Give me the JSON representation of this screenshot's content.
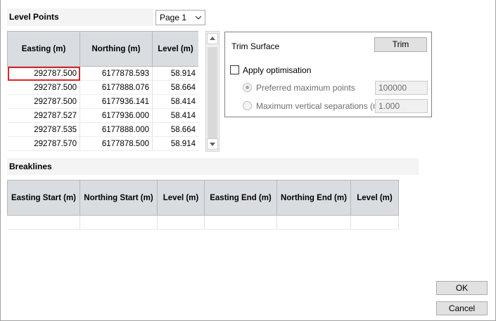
{
  "level_points": {
    "title": "Level Points",
    "page_select": {
      "value": "Page 1"
    },
    "columns": [
      "Easting (m)",
      "Northing (m)",
      "Level (m)"
    ],
    "rows": [
      [
        "292787.500",
        "6177878.593",
        "58.914"
      ],
      [
        "292787.500",
        "6177888.076",
        "58.664"
      ],
      [
        "292787.500",
        "6177936.141",
        "58.414"
      ],
      [
        "292787.527",
        "6177936.000",
        "58.414"
      ],
      [
        "292787.535",
        "6177888.000",
        "58.664"
      ],
      [
        "292787.570",
        "6177878.500",
        "58.914"
      ]
    ]
  },
  "trim": {
    "label": "Trim Surface",
    "button": "Trim",
    "apply_optimisation": {
      "label": "Apply optimisation",
      "checked": false
    },
    "preferred_max_points": {
      "label": "Preferred maximum points",
      "value": "100000",
      "selected": true
    },
    "max_vertical_sep": {
      "label": "Maximum vertical separations (m)",
      "value": "1.000",
      "selected": false
    }
  },
  "breaklines": {
    "title": "Breaklines",
    "columns": [
      "Easting Start (m)",
      "Northing Start (m)",
      "Level (m)",
      "Easting End (m)",
      "Northing End (m)",
      "Level (m)"
    ]
  },
  "buttons": {
    "ok": "OK",
    "cancel": "Cancel"
  },
  "colors": {
    "header_bg": "#d9dde1",
    "selected_border": "#d9262b"
  },
  "icons": {
    "combo": "chevron-down-icon",
    "scroll_up": "arrow-up-icon",
    "scroll_down": "arrow-down-icon"
  }
}
